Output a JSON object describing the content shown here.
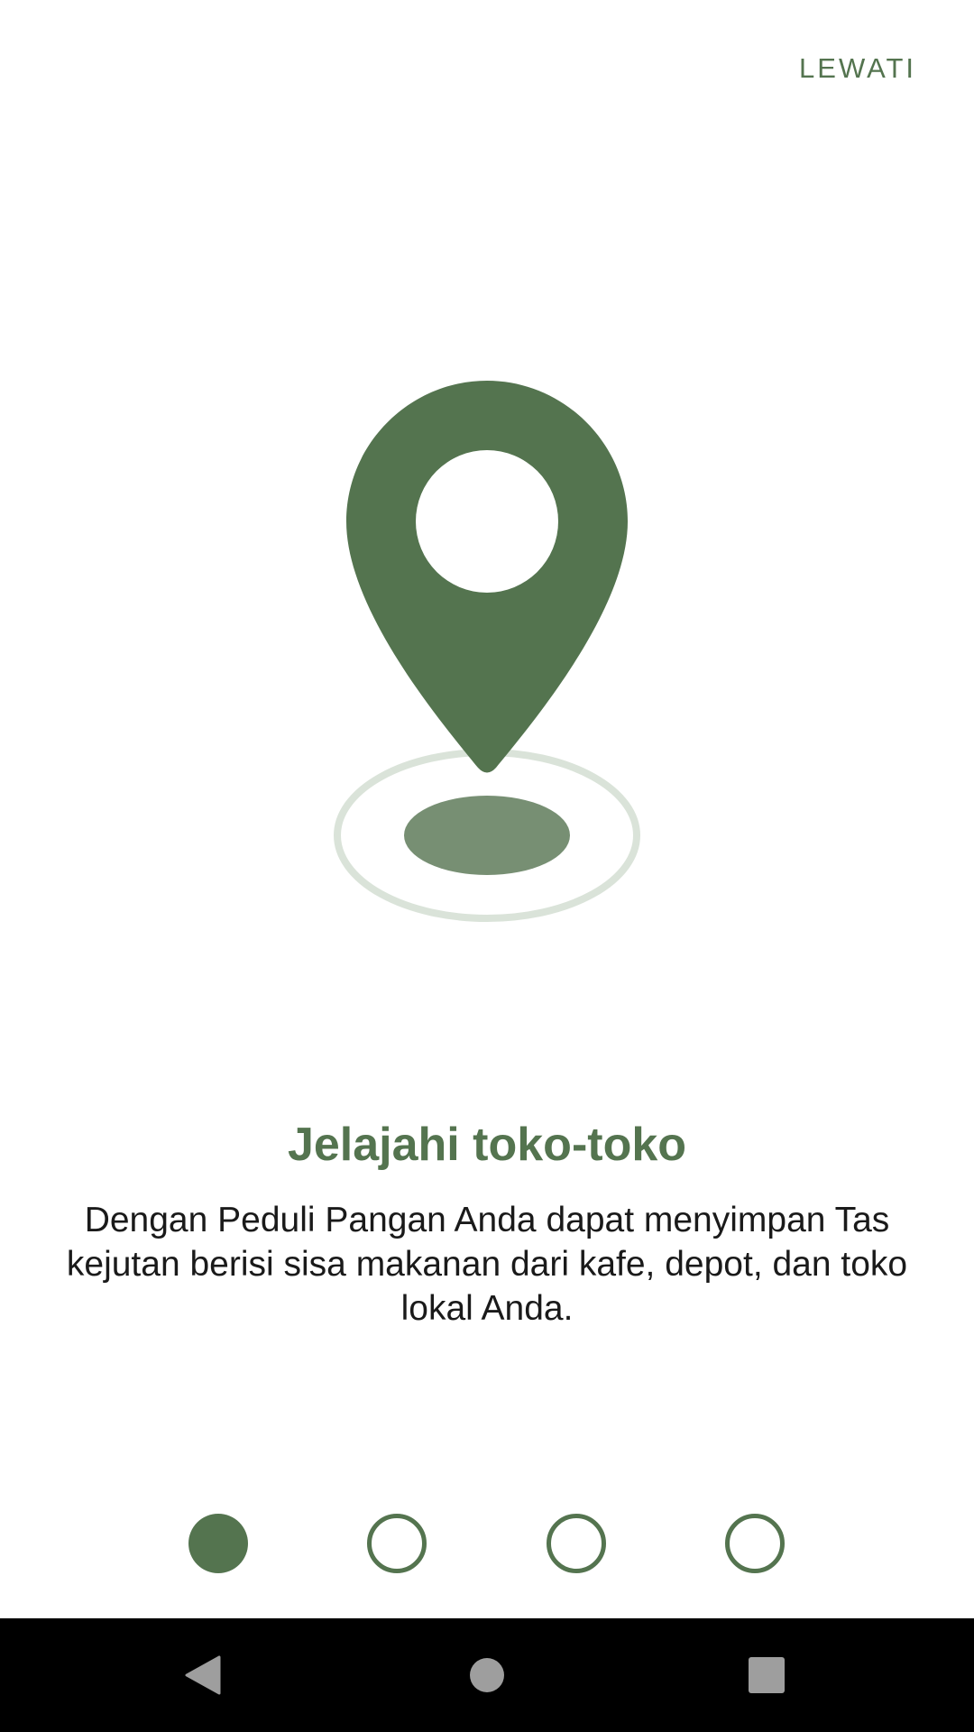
{
  "header": {
    "skip_label": "LEWATI"
  },
  "illustration": {
    "icon": "location-pin-icon",
    "colors": {
      "pin": "#54744f",
      "ring": "#dae3d9",
      "shadow": "#778f73"
    }
  },
  "onboarding": {
    "title": "Jelajahi toko-toko",
    "description": "Dengan Peduli Pangan Anda dapat menyimpan Tas kejutan berisi sisa makanan dari kafe, depot, dan toko lokal Anda."
  },
  "pager": {
    "total_pages": 4,
    "current_page": 1
  },
  "navigation_bar": {
    "buttons": [
      "back-icon",
      "home-icon",
      "recents-icon"
    ]
  },
  "theme": {
    "accent": "#54744f",
    "text": "#1a1a1a",
    "background": "#ffffff",
    "nav_background": "#000000",
    "nav_icon": "#9e9e9e"
  }
}
